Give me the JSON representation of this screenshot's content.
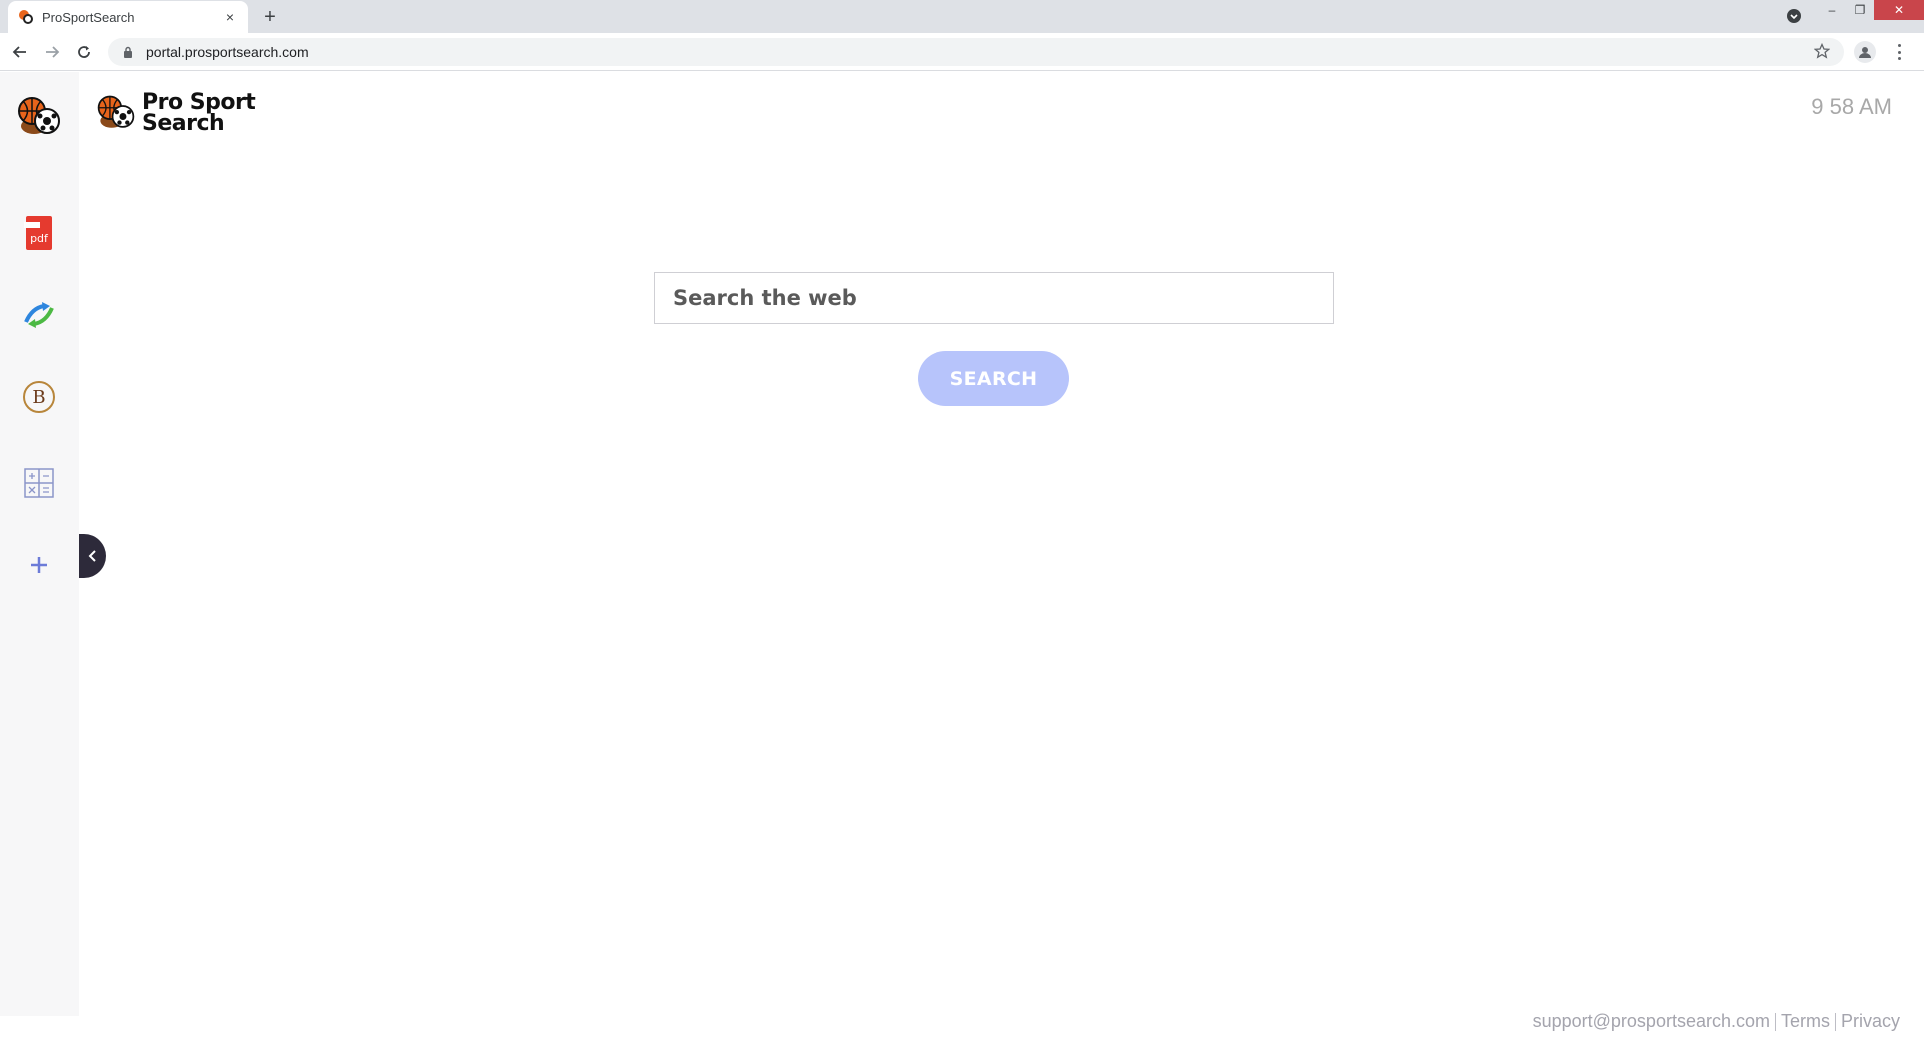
{
  "browser": {
    "tab_title": "ProSportSearch",
    "tab_close": "×",
    "new_tab": "+",
    "url": "portal.prosportsearch.com",
    "window_close": "✕",
    "window_minimize": "–",
    "window_restore": "❐"
  },
  "page": {
    "logo_line1": "Pro Sport",
    "logo_line2": "Search",
    "clock": "9 58 AM",
    "search_placeholder": "Search the web",
    "search_button": "SEARCH"
  },
  "sidebar": {
    "items": [
      {
        "icon": "sports-balls-icon"
      },
      {
        "icon": "pdf-icon",
        "label": "pdf"
      },
      {
        "icon": "swirl-arrow-icon"
      },
      {
        "icon": "bitcoin-b-icon",
        "label": "B"
      },
      {
        "icon": "calculator-icon"
      },
      {
        "icon": "plus-icon",
        "label": "+"
      }
    ]
  },
  "footer": {
    "email": "support@prosportsearch.com",
    "terms": "Terms",
    "privacy": "Privacy"
  },
  "colors": {
    "accent": "#b7c4fb",
    "sidebar_bg": "#f7f7f8",
    "collapse_tab": "#2d2a3a",
    "window_close": "#c9454b"
  }
}
